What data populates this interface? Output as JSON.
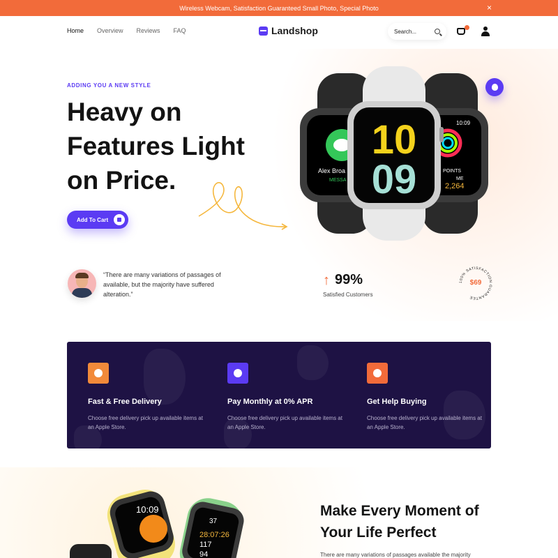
{
  "announcement": {
    "text": "Wireless Webcam, Satisfaction Guaranteed  Small Photo, Special Photo",
    "close": "×"
  },
  "nav": {
    "links": [
      "Home",
      "Overview",
      "Reviews",
      "FAQ"
    ],
    "active": "Home"
  },
  "brand": {
    "name": "Landshop",
    "color": "#5b3bf3"
  },
  "search": {
    "placeholder": "Search..."
  },
  "cart": {
    "count": ""
  },
  "hero": {
    "eyebrow": "ADDING YOU A NEW STYLE",
    "title_line1": "Heavy on",
    "title_line2": "Features Light",
    "title_line3": "on Price.",
    "cta": "Add To Cart",
    "watch_screen": {
      "left_name": "Alex Broa",
      "left_sub": "MESSA",
      "center_hour": "10",
      "center_minute": "09",
      "right_time": "10:09",
      "right_label": "POINTS",
      "right_me": "ME",
      "right_points": "2,264"
    }
  },
  "testimonial": {
    "quote": "“There are many variations of passages of available, but the majority have suffered alteration.”"
  },
  "stat": {
    "value": "99%",
    "label": "Satisfied Customers"
  },
  "seal": {
    "ring_text": "100% SATISFACTION GUARANTEE",
    "price": "$69"
  },
  "features": [
    {
      "title": "Fast & Free Delivery",
      "text": "Choose free delivery pick up available items at an Apple Store.",
      "icon": "box-icon",
      "color": "#f28a3a"
    },
    {
      "title": "Pay Monthly at 0% APR",
      "text": "Choose free delivery pick up available items at an Apple Store.",
      "icon": "dollar-icon",
      "color": "#5b3bf3"
    },
    {
      "title": "Get Help Buying",
      "text": "Choose free delivery pick up available items at an Apple Store.",
      "icon": "chat-icon",
      "color": "#f26b3a"
    }
  ],
  "section": {
    "title_line1": "Make Every Moment of",
    "title_line2": "Your Life Perfect",
    "text": "There are many variations of passages available the majority",
    "watch_screen": {
      "left_time": "10:09",
      "right_time1": "37",
      "right_time2": "28:07:26",
      "right_num1": "117",
      "right_num2": "94"
    }
  },
  "colors": {
    "accent": "#5b3bf3",
    "orange": "#f26b3a",
    "dark_panel": "#1e1244"
  }
}
